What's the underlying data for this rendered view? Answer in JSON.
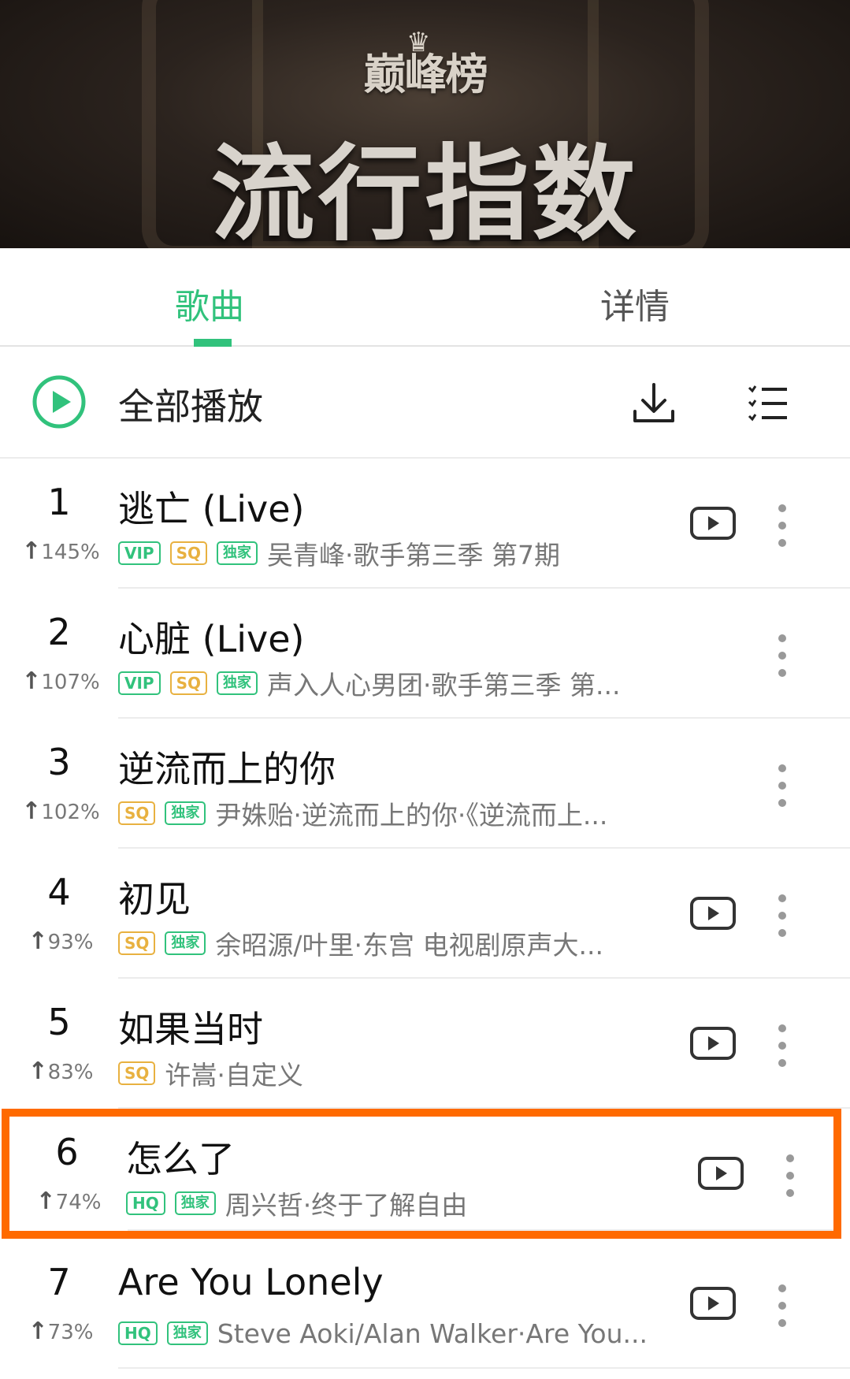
{
  "banner": {
    "logo": "巅峰榜",
    "title": "流行指数"
  },
  "tabs": [
    {
      "label": "歌曲",
      "active": true
    },
    {
      "label": "详情",
      "active": false
    }
  ],
  "play_all": {
    "label": "全部播放",
    "icons": [
      "play-circle-icon",
      "download-icon",
      "list-menu-icon"
    ]
  },
  "colors": {
    "accent": "#31c27c",
    "sq_badge": "#e8b140",
    "highlight_border": "#ff6a00"
  },
  "songs": [
    {
      "rank": "1",
      "trend": "145%",
      "title": "逃亡 (Live)",
      "badges": [
        "VIP",
        "SQ",
        "独家"
      ],
      "artist": "吴青峰·歌手第三季 第7期",
      "has_mv": true
    },
    {
      "rank": "2",
      "trend": "107%",
      "title": "心脏 (Live)",
      "badges": [
        "VIP",
        "SQ",
        "独家"
      ],
      "artist": "声入人心男团·歌手第三季 第...",
      "has_mv": false
    },
    {
      "rank": "3",
      "trend": "102%",
      "title": "逆流而上的你",
      "badges": [
        "SQ",
        "独家"
      ],
      "artist": "尹姝贻·逆流而上的你·《逆流而上...",
      "has_mv": false
    },
    {
      "rank": "4",
      "trend": "93%",
      "title": "初见",
      "badges": [
        "SQ",
        "独家"
      ],
      "artist": "余昭源/叶里·东宫 电视剧原声大...",
      "has_mv": true
    },
    {
      "rank": "5",
      "trend": "83%",
      "title": "如果当时",
      "badges": [
        "SQ"
      ],
      "artist": "许嵩·自定义",
      "has_mv": true
    },
    {
      "rank": "6",
      "trend": "74%",
      "title": "怎么了",
      "badges": [
        "HQ",
        "独家"
      ],
      "artist": "周兴哲·终于了解自由",
      "has_mv": true,
      "highlighted": true
    },
    {
      "rank": "7",
      "trend": "73%",
      "title": "Are You Lonely",
      "badges": [
        "HQ",
        "独家"
      ],
      "artist": "Steve Aoki/Alan Walker·Are You...",
      "has_mv": true
    }
  ]
}
